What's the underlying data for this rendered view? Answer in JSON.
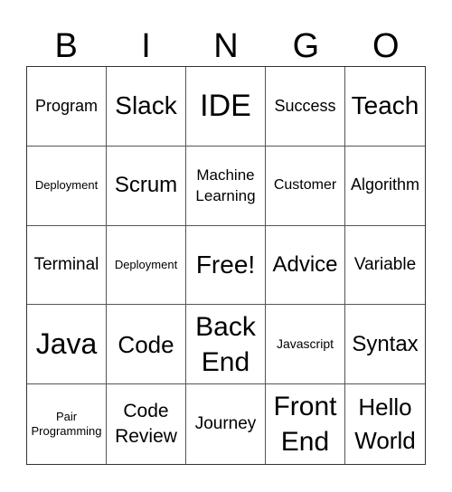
{
  "header": {
    "letters": [
      "B",
      "I",
      "N",
      "G",
      "O"
    ]
  },
  "cells": [
    {
      "text": "Program"
    },
    {
      "text": "Slack"
    },
    {
      "text": "IDE"
    },
    {
      "text": "Success"
    },
    {
      "text": "Teach"
    },
    {
      "text": "Deployment"
    },
    {
      "text": "Scrum"
    },
    {
      "text": "Machine Learning"
    },
    {
      "text": "Customer"
    },
    {
      "text": "Algorithm"
    },
    {
      "text": "Terminal"
    },
    {
      "text": "Deployment"
    },
    {
      "text": "Free!"
    },
    {
      "text": "Advice"
    },
    {
      "text": "Variable"
    },
    {
      "text": "Java"
    },
    {
      "text": "Code"
    },
    {
      "text": "Back End"
    },
    {
      "text": "Javascript"
    },
    {
      "text": "Syntax"
    },
    {
      "text": "Pair Programming"
    },
    {
      "text": "Code Review"
    },
    {
      "text": "Journey"
    },
    {
      "text": "Front End"
    },
    {
      "text": "Hello World"
    }
  ]
}
